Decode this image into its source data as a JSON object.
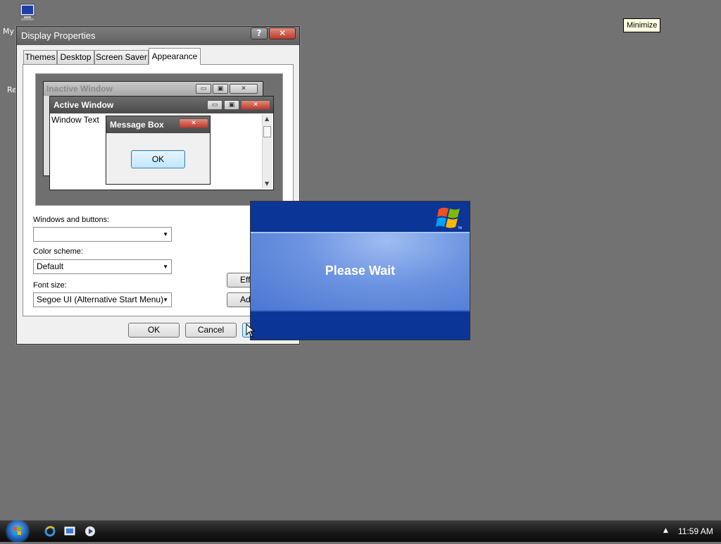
{
  "desktop": {
    "my_computer_label": "My",
    "recycle_label": "Re",
    "tooltip": "Minimize"
  },
  "dialog": {
    "title": "Display Properties",
    "help_glyph": "?",
    "close_glyph": "✕",
    "tabs": [
      {
        "label": "Themes"
      },
      {
        "label": "Desktop"
      },
      {
        "label": "Screen Saver"
      },
      {
        "label": "Appearance",
        "active": true
      }
    ],
    "preview": {
      "inactive_title": "Inactive Window",
      "active_title": "Active Window",
      "window_text": "Window Text",
      "msgbox_title": "Message Box",
      "msgbox_ok": "OK"
    },
    "windows_buttons_label": "Windows and buttons:",
    "windows_buttons_value": "",
    "color_scheme_label": "Color scheme:",
    "color_scheme_value": "Default",
    "font_size_label": "Font size:",
    "font_size_value": "Segoe UI (Alternative Start Menu)",
    "effects_button": "Eff",
    "advanced_button": "Adv",
    "ok_button": "OK",
    "cancel_button": "Cancel"
  },
  "splash": {
    "text": "Please Wait",
    "colors": {
      "dark": "#0b3597",
      "band": "#6b93e0"
    }
  },
  "taskbar": {
    "clock": "11:59 AM",
    "tray_arrow": "▲"
  }
}
